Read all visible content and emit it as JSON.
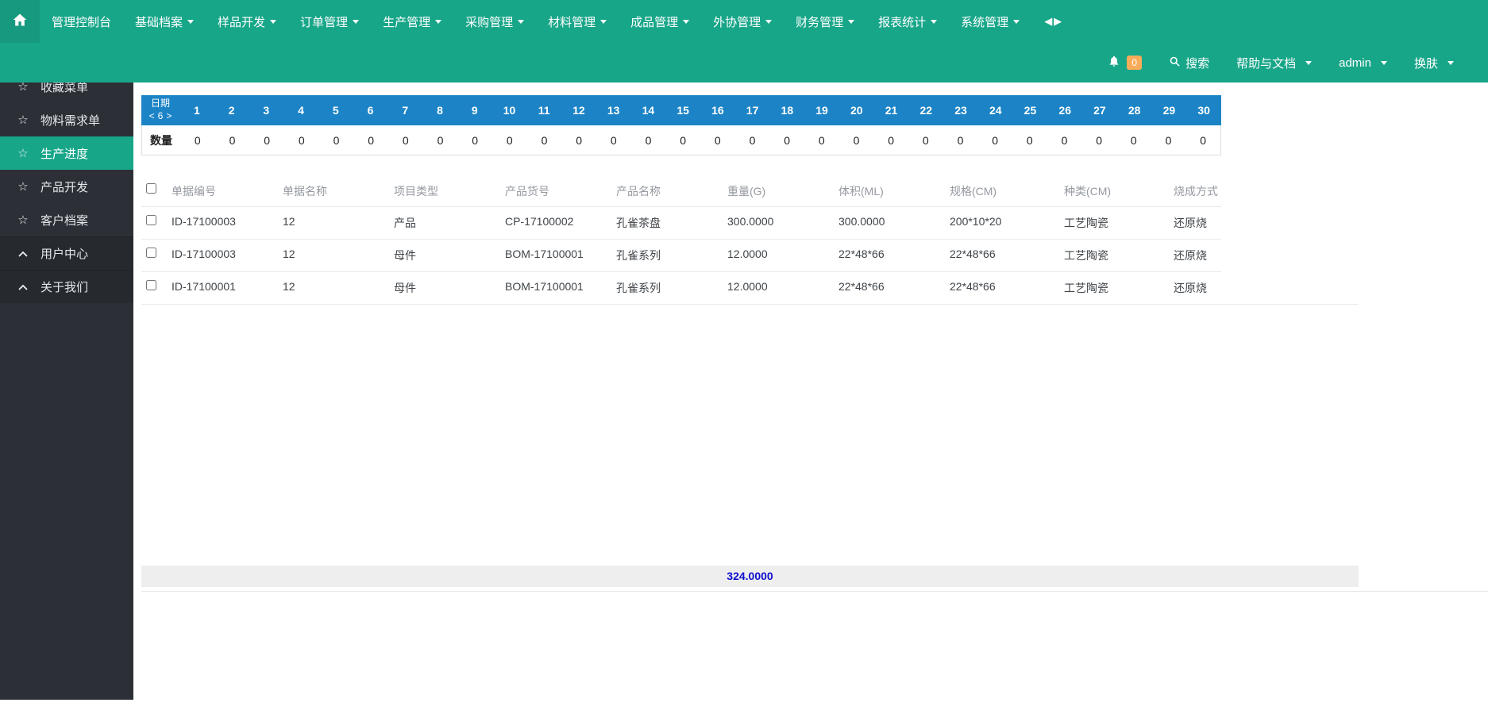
{
  "colors": {
    "brand_teal": "#18A689",
    "calendar_blue": "#1C84C6",
    "badge_orange": "#F8AC59",
    "total_blue": "#0D0DD0",
    "sidebar_dark": "#2C2F36"
  },
  "topnav": {
    "items": [
      {
        "label": "管理控制台",
        "caret": false
      },
      {
        "label": "基础档案",
        "caret": true
      },
      {
        "label": "样品开发",
        "caret": true
      },
      {
        "label": "订单管理",
        "caret": true
      },
      {
        "label": "生产管理",
        "caret": true
      },
      {
        "label": "采购管理",
        "caret": true
      },
      {
        "label": "材料管理",
        "caret": true
      },
      {
        "label": "成品管理",
        "caret": true
      },
      {
        "label": "外协管理",
        "caret": true
      },
      {
        "label": "财务管理",
        "caret": true
      },
      {
        "label": "报表统计",
        "caret": true
      },
      {
        "label": "系统管理",
        "caret": true
      }
    ],
    "collapse_toggle": "◀▶"
  },
  "toolbar": {
    "badge_count": "0",
    "search_label": "搜索",
    "help_label": "帮助与文档",
    "user_label": "admin",
    "skin_label": "换肤"
  },
  "sidebar": {
    "items": [
      {
        "label": "收藏菜单",
        "active": false,
        "section": false
      },
      {
        "label": "物料需求单",
        "active": false,
        "section": false
      },
      {
        "label": "生产进度",
        "active": true,
        "section": false
      },
      {
        "label": "产品开发",
        "active": false,
        "section": false
      },
      {
        "label": "客户档案",
        "active": false,
        "section": false
      },
      {
        "label": "用户中心",
        "active": false,
        "section": true
      },
      {
        "label": "关于我们",
        "active": false,
        "section": true
      }
    ]
  },
  "calendar": {
    "label": "日期",
    "pager_prev": "<",
    "pager_label": "6",
    "pager_next": ">",
    "days": [
      "1",
      "2",
      "3",
      "4",
      "5",
      "6",
      "7",
      "8",
      "9",
      "10",
      "11",
      "12",
      "13",
      "14",
      "15",
      "16",
      "17",
      "18",
      "19",
      "20",
      "21",
      "22",
      "23",
      "24",
      "25",
      "26",
      "27",
      "28",
      "29",
      "30"
    ],
    "qty_label": "数量",
    "quantities": [
      "0",
      "0",
      "0",
      "0",
      "0",
      "0",
      "0",
      "0",
      "0",
      "0",
      "0",
      "0",
      "0",
      "0",
      "0",
      "0",
      "0",
      "0",
      "0",
      "0",
      "0",
      "0",
      "0",
      "0",
      "0",
      "0",
      "0",
      "0",
      "0",
      "0"
    ]
  },
  "table": {
    "columns": [
      "单据编号",
      "单据名称",
      "项目类型",
      "产品货号",
      "产品名称",
      "重量(G)",
      "体积(ML)",
      "规格(CM)",
      "种类(CM)",
      "烧成方式"
    ],
    "rows": [
      [
        "ID-17100003",
        "12",
        "产品",
        "CP-17100002",
        "孔雀茶盘",
        "300.0000",
        "300.0000",
        "200*10*20",
        "工艺陶瓷",
        "还原烧"
      ],
      [
        "ID-17100003",
        "12",
        "母件",
        "BOM-17100001",
        "孔雀系列",
        "12.0000",
        "22*48*66",
        "22*48*66",
        "工艺陶瓷",
        "还原烧"
      ],
      [
        "ID-17100001",
        "12",
        "母件",
        "BOM-17100001",
        "孔雀系列",
        "12.0000",
        "22*48*66",
        "22*48*66",
        "工艺陶瓷",
        "还原烧"
      ]
    ],
    "total": "324.0000"
  }
}
